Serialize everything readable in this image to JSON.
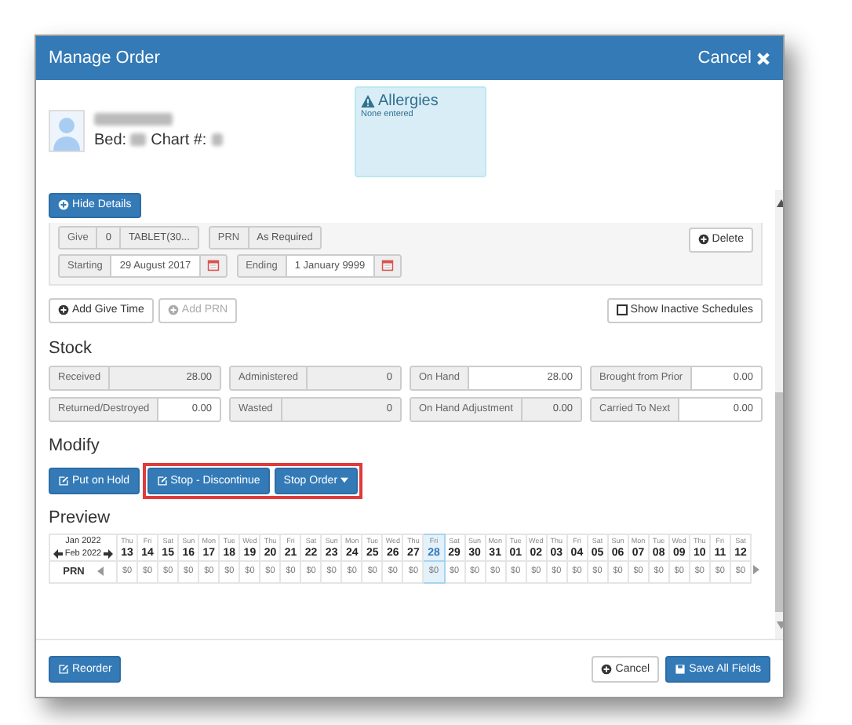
{
  "dialog": {
    "title": "Manage Order",
    "cancel_label": "Cancel"
  },
  "patient": {
    "bed_label": "Bed:",
    "chart_label": "Chart #:"
  },
  "allergies": {
    "title": "Allergies",
    "text": "None entered"
  },
  "hide_details_button": "Hide Details",
  "schedule": {
    "give_label": "Give",
    "give_value": "0",
    "unit": "TABLET(30...",
    "frequency_label": "PRN",
    "frequency_value": "As Required",
    "delete_button": "Delete",
    "starting_label": "Starting",
    "starting_value": "29 August 2017",
    "ending_label": "Ending",
    "ending_value": "1 January 9999"
  },
  "schedule_buttons": [
    {
      "label": "Add Give Time",
      "disabled": false
    },
    {
      "label": "Add PRN",
      "disabled": true
    }
  ],
  "show_inactive": {
    "label": "Show Inactive Schedules",
    "checked": false
  },
  "stock": {
    "heading": "Stock",
    "fields": [
      {
        "label": "Received",
        "value": "28.00",
        "editable": false
      },
      {
        "label": "Administered",
        "value": "0",
        "editable": false
      },
      {
        "label": "On Hand",
        "value": "28.00",
        "editable": true
      },
      {
        "label": "Brought from Prior",
        "value": "0.00",
        "editable": true
      },
      {
        "label": "Returned/Destroyed",
        "value": "0.00",
        "editable": true
      },
      {
        "label": "Wasted",
        "value": "0",
        "editable": false
      },
      {
        "label": "On Hand Adjustment",
        "value": "0.00",
        "editable": false
      },
      {
        "label": "Carried To Next",
        "value": "0.00",
        "editable": true
      }
    ]
  },
  "modify": {
    "heading": "Modify",
    "buttons": [
      {
        "label": "Put on Hold",
        "kind": "edit",
        "highlighted": false
      },
      {
        "label": "Stop - Discontinue",
        "kind": "edit",
        "highlighted": true
      },
      {
        "label": "Stop Order",
        "kind": "dropdown",
        "highlighted": true
      }
    ]
  },
  "preview": {
    "heading": "Preview",
    "month": "Jan 2022",
    "next_month": "Feb 2022",
    "row_label": "PRN",
    "days": [
      {
        "weekday": "Thu",
        "date": "13",
        "value": "$0",
        "selected": false
      },
      {
        "weekday": "Fri",
        "date": "14",
        "value": "$0",
        "selected": false
      },
      {
        "weekday": "Sat",
        "date": "15",
        "value": "$0",
        "selected": false
      },
      {
        "weekday": "Sun",
        "date": "16",
        "value": "$0",
        "selected": false
      },
      {
        "weekday": "Mon",
        "date": "17",
        "value": "$0",
        "selected": false
      },
      {
        "weekday": "Tue",
        "date": "18",
        "value": "$0",
        "selected": false
      },
      {
        "weekday": "Wed",
        "date": "19",
        "value": "$0",
        "selected": false
      },
      {
        "weekday": "Thu",
        "date": "20",
        "value": "$0",
        "selected": false
      },
      {
        "weekday": "Fri",
        "date": "21",
        "value": "$0",
        "selected": false
      },
      {
        "weekday": "Sat",
        "date": "22",
        "value": "$0",
        "selected": false
      },
      {
        "weekday": "Sun",
        "date": "23",
        "value": "$0",
        "selected": false
      },
      {
        "weekday": "Mon",
        "date": "24",
        "value": "$0",
        "selected": false
      },
      {
        "weekday": "Tue",
        "date": "25",
        "value": "$0",
        "selected": false
      },
      {
        "weekday": "Wed",
        "date": "26",
        "value": "$0",
        "selected": false
      },
      {
        "weekday": "Thu",
        "date": "27",
        "value": "$0",
        "selected": false
      },
      {
        "weekday": "Fri",
        "date": "28",
        "value": "$0",
        "selected": true
      },
      {
        "weekday": "Sat",
        "date": "29",
        "value": "$0",
        "selected": false
      },
      {
        "weekday": "Sun",
        "date": "30",
        "value": "$0",
        "selected": false
      },
      {
        "weekday": "Mon",
        "date": "31",
        "value": "$0",
        "selected": false
      },
      {
        "weekday": "Tue",
        "date": "01",
        "value": "$0",
        "selected": false
      },
      {
        "weekday": "Wed",
        "date": "02",
        "value": "$0",
        "selected": false
      },
      {
        "weekday": "Thu",
        "date": "03",
        "value": "$0",
        "selected": false
      },
      {
        "weekday": "Fri",
        "date": "04",
        "value": "$0",
        "selected": false
      },
      {
        "weekday": "Sat",
        "date": "05",
        "value": "$0",
        "selected": false
      },
      {
        "weekday": "Sun",
        "date": "06",
        "value": "$0",
        "selected": false
      },
      {
        "weekday": "Mon",
        "date": "07",
        "value": "$0",
        "selected": false
      },
      {
        "weekday": "Tue",
        "date": "08",
        "value": "$0",
        "selected": false
      },
      {
        "weekday": "Wed",
        "date": "09",
        "value": "$0",
        "selected": false
      },
      {
        "weekday": "Thu",
        "date": "10",
        "value": "$0",
        "selected": false
      },
      {
        "weekday": "Fri",
        "date": "11",
        "value": "$0",
        "selected": false
      },
      {
        "weekday": "Sat",
        "date": "12",
        "value": "$0",
        "selected": false
      }
    ]
  },
  "footer": {
    "reorder": "Reorder",
    "cancel": "Cancel",
    "save": "Save All Fields"
  }
}
